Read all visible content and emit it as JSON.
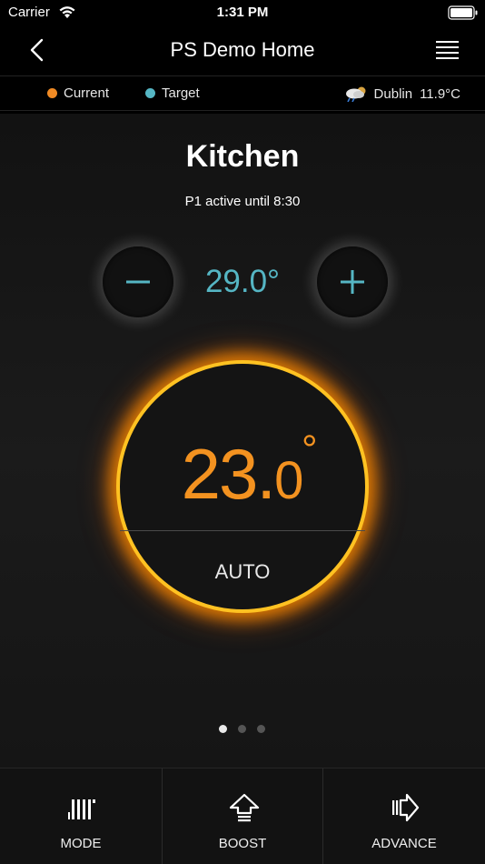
{
  "status_bar": {
    "carrier": "Carrier",
    "time": "1:31 PM"
  },
  "nav": {
    "title": "PS Demo Home",
    "back_icon": "chevron-left-icon",
    "menu_icon": "hamburger-menu-icon"
  },
  "legend": {
    "current_label": "Current",
    "current_color": "#f08a24",
    "target_label": "Target",
    "target_color": "#55b6c4"
  },
  "weather": {
    "icon": "cloud-rain-icon",
    "city": "Dublin",
    "temperature": "11.9°C"
  },
  "room": {
    "name": "Kitchen",
    "schedule": "P1 active until 8:30"
  },
  "target": {
    "temperature": "29.0°",
    "minus_icon": "minus-icon",
    "plus_icon": "plus-icon"
  },
  "dial": {
    "temp_int": "23.",
    "temp_dec": "0",
    "degree": "°",
    "mode": "AUTO",
    "accent_color": "#f39220"
  },
  "pager": {
    "count": 3,
    "active_index": 0
  },
  "tabs": [
    {
      "label": "MODE",
      "icon": "radiator-icon"
    },
    {
      "label": "BOOST",
      "icon": "boost-arrow-icon"
    },
    {
      "label": "ADVANCE",
      "icon": "advance-arrow-icon"
    }
  ]
}
